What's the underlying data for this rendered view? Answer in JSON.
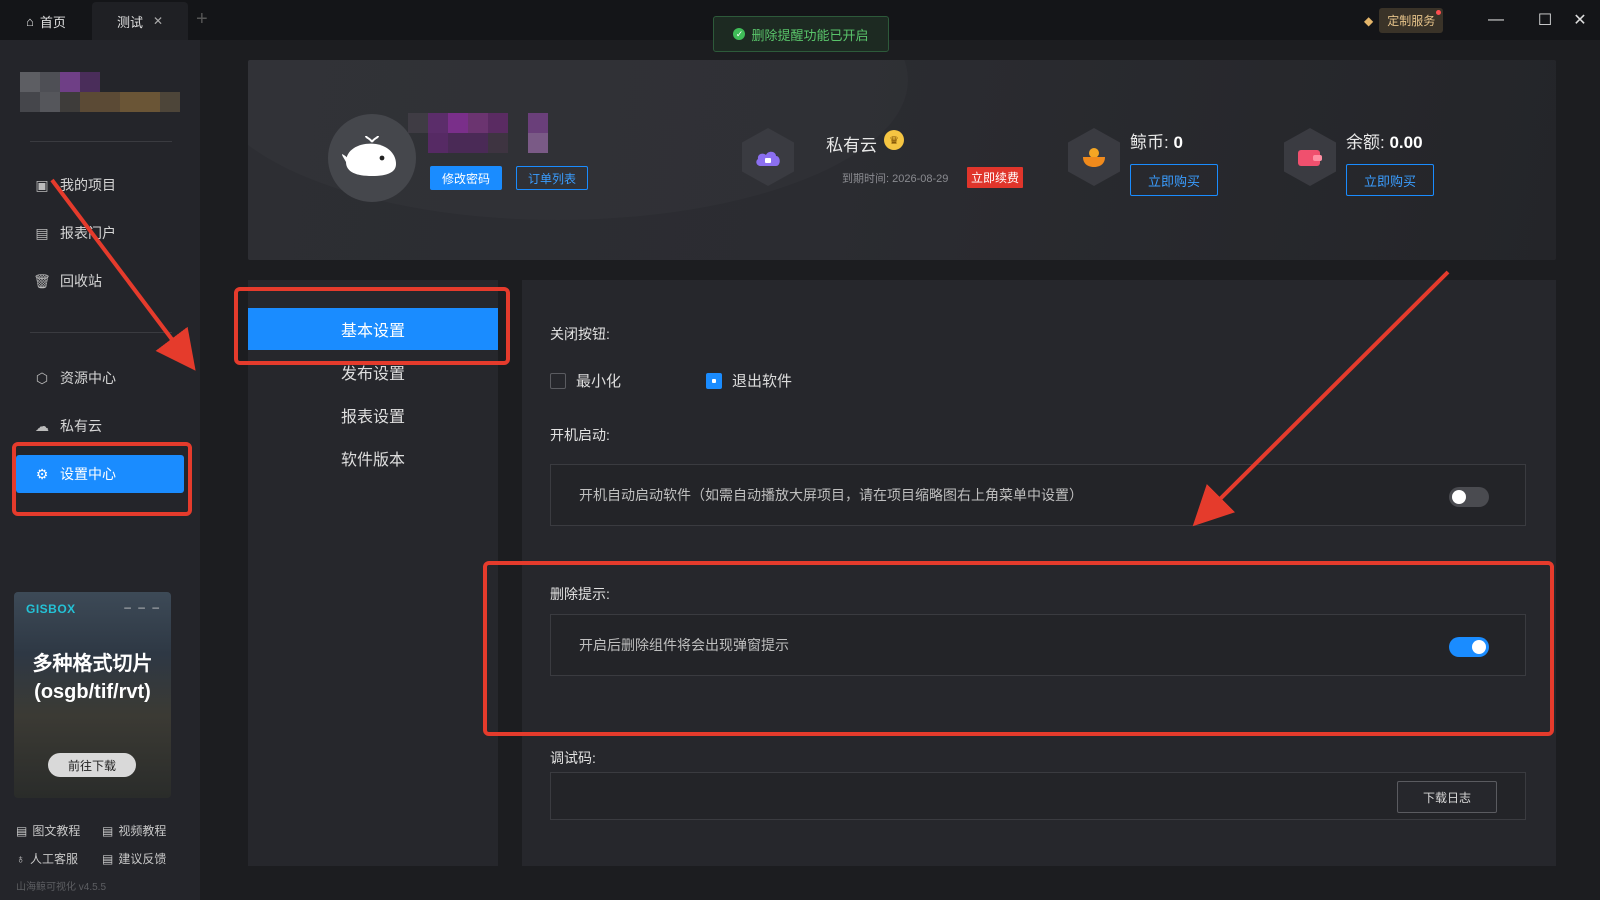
{
  "tabs": [
    {
      "label": "首页",
      "icon": "home-icon"
    },
    {
      "label": "测试",
      "icon": "close-icon"
    }
  ],
  "toast": {
    "text": "删除提醒功能已开启"
  },
  "window": {
    "custom_service": "定制服务"
  },
  "sidebar": {
    "items": [
      {
        "label": "我的项目",
        "icon": "project-icon"
      },
      {
        "label": "报表门户",
        "icon": "report-icon"
      },
      {
        "label": "回收站",
        "icon": "trash-icon"
      },
      {
        "label": "资源中心",
        "icon": "resource-icon"
      },
      {
        "label": "私有云",
        "icon": "cloud-icon"
      },
      {
        "label": "设置中心",
        "icon": "gear-icon"
      }
    ],
    "promo": {
      "brand": "GISBOX",
      "title_line1": "多种格式切片",
      "title_line2": "(osgb/tif/rvt)",
      "button": "前往下载"
    },
    "help": [
      {
        "label": "图文教程"
      },
      {
        "label": "视频教程"
      },
      {
        "label": "人工客服"
      },
      {
        "label": "建议反馈"
      }
    ],
    "version": "山海鲸可视化 v4.5.5"
  },
  "profile": {
    "change_password": "修改密码",
    "order_list": "订单列表",
    "private_cloud": {
      "title": "私有云",
      "expire_label": "到期时间: 2026-08-29",
      "renew": "立即续费"
    },
    "coins": {
      "label": "鲸币: ",
      "value": "0",
      "buy": "立即购买"
    },
    "balance": {
      "label": "余额: ",
      "value": "0.00",
      "buy": "立即购买"
    }
  },
  "settings_menu": [
    "基本设置",
    "发布设置",
    "报表设置",
    "软件版本"
  ],
  "settings": {
    "close_button": {
      "title": "关闭按钮:",
      "options": [
        {
          "label": "最小化",
          "checked": false
        },
        {
          "label": "退出软件",
          "checked": true
        }
      ]
    },
    "startup": {
      "title": "开机启动:",
      "description": "开机自动启动软件（如需自动播放大屏项目，请在项目缩略图右上角菜单中设置）",
      "enabled": false
    },
    "delete_hint": {
      "title": "删除提示:",
      "description": "开启后删除组件将会出现弹窗提示",
      "enabled": true
    },
    "debug": {
      "title": "调试码:",
      "download_log": "下载日志"
    }
  },
  "colors": {
    "accent": "#1a8cff",
    "annotation": "#e53b2c",
    "toast_text": "#59c46a"
  }
}
